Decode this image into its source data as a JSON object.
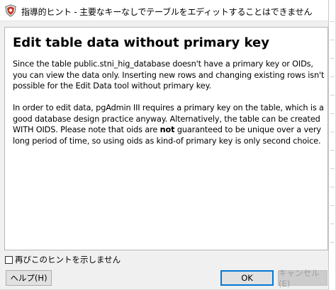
{
  "window": {
    "title": "指導的ヒント - 主要なキーなしでテーブルをエディットすることはできません"
  },
  "hint": {
    "heading": "Edit table data without primary key",
    "paragraph1": "Since the table public.stni_hig_database doesn't have a primary key or OIDs, you can view the data only. Inserting new rows and changing existing rows isn't possible for the Edit Data tool without primary key.",
    "paragraph2_before_bold": "In order to edit data, pgAdmin III requires a primary key on the table, which is a good database design practice anyway. Alternatively, the table can be created WITH OIDS. Please note that oids are ",
    "paragraph2_bold": "not",
    "paragraph2_after_bold": " guaranteed to be unique over a very long period of time, so using oids as kind-of primary key is only second choice."
  },
  "checkbox": {
    "label": "再びこのヒントを示しません",
    "checked": false
  },
  "buttons": {
    "help": "ヘルプ(H)",
    "ok": "OK",
    "cancel": "キャンセル(E)"
  },
  "colors": {
    "focus_border": "#0078d7",
    "disabled_text": "#a0a0a0",
    "app_icon_red": "#c0392b"
  }
}
